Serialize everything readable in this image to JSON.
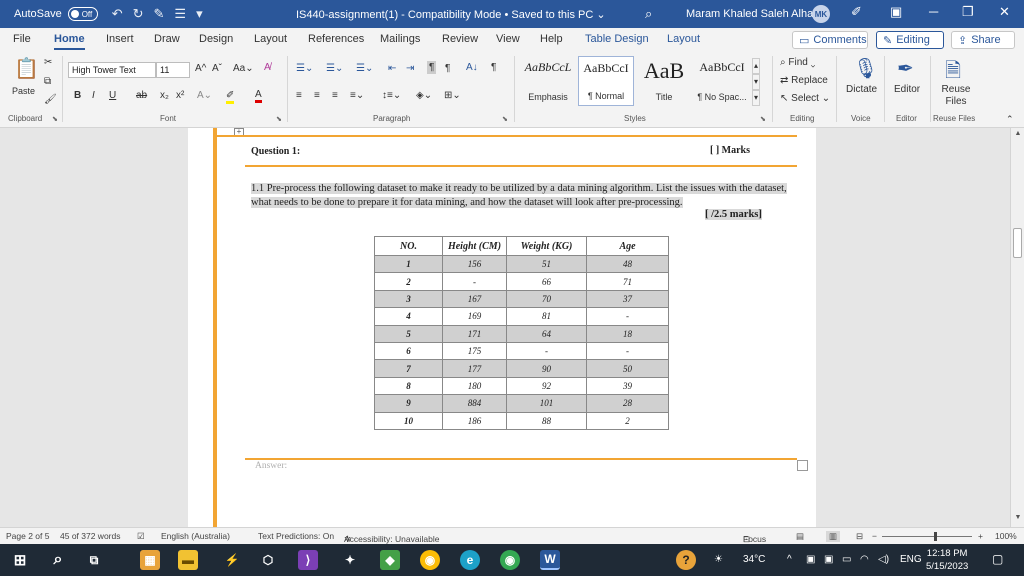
{
  "titlebar": {
    "autosave_label": "AutoSave",
    "autosave_state": "Off",
    "document_title": "IS440-assignment(1)  -  Compatibility Mode  •  Saved to this PC ⌄",
    "user_name": "Maram Khaled Saleh Alharbi",
    "user_initials": "MK"
  },
  "tabs": [
    {
      "label": "File"
    },
    {
      "label": "Home"
    },
    {
      "label": "Insert"
    },
    {
      "label": "Draw"
    },
    {
      "label": "Design"
    },
    {
      "label": "Layout"
    },
    {
      "label": "References"
    },
    {
      "label": "Mailings"
    },
    {
      "label": "Review"
    },
    {
      "label": "View"
    },
    {
      "label": "Help"
    },
    {
      "label": "Table Design"
    },
    {
      "label": "Layout"
    }
  ],
  "ribbon_actions": {
    "comments": "Comments",
    "editing": "Editing",
    "share": "Share"
  },
  "ribbon": {
    "paste": "Paste",
    "font_name": "High Tower Text",
    "font_size": "11",
    "styles": [
      {
        "preview": "AaBbCcL",
        "name": "Emphasis"
      },
      {
        "preview": "AaBbCcI",
        "name": "¶ Normal"
      },
      {
        "preview": "AaB",
        "name": "Title"
      },
      {
        "preview": "AaBbCcI",
        "name": "¶ No Spac..."
      }
    ],
    "find": "Find",
    "replace": "Replace",
    "select": "Select",
    "dictate": "Dictate",
    "editor": "Editor",
    "reuse_files": "Reuse Files",
    "groups": {
      "clipboard": "Clipboard",
      "font": "Font",
      "paragraph": "Paragraph",
      "styles": "Styles",
      "editing": "Editing",
      "voice": "Voice",
      "editor": "Editor",
      "reuse": "Reuse Files"
    }
  },
  "document": {
    "question_title": "Question 1:",
    "question_marks": "[    ] Marks",
    "question_text": "1.1 Pre-process the following dataset to make it ready to be utilized by a data mining algorithm. List the issues with the dataset, what needs to be done to prepare it for data mining, and how the dataset will look after pre-processing.",
    "question_points": "[    /2.5 marks]",
    "answer_label": "Answer:",
    "table": {
      "headers": [
        "NO.",
        "Height (CM)",
        "Weight (KG)",
        "Age"
      ],
      "rows": [
        [
          "1",
          "156",
          "51",
          "48"
        ],
        [
          "2",
          "-",
          "66",
          "71"
        ],
        [
          "3",
          "167",
          "70",
          "37"
        ],
        [
          "4",
          "169",
          "81",
          "-"
        ],
        [
          "5",
          "171",
          "64",
          "18"
        ],
        [
          "6",
          "175",
          "-",
          "-"
        ],
        [
          "7",
          "177",
          "90",
          "50"
        ],
        [
          "8",
          "180",
          "92",
          "39"
        ],
        [
          "9",
          "884",
          "101",
          "28"
        ],
        [
          "10",
          "186",
          "88",
          "2"
        ]
      ]
    }
  },
  "statusbar": {
    "page": "Page 2 of 5",
    "words": "45 of 372 words",
    "language": "English (Australia)",
    "predictions": "Text Predictions: On",
    "accessibility": "Accessibility: Unavailable",
    "focus": "Focus",
    "zoom": "100%"
  },
  "taskbar": {
    "weather": "34°C",
    "language": "ENG",
    "time": "12:18 PM",
    "date": "5/15/2023"
  }
}
